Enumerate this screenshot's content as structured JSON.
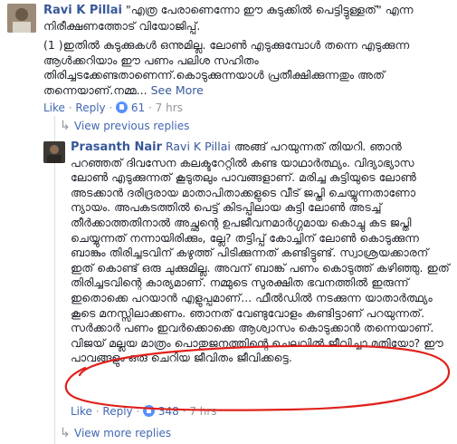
{
  "comment1": {
    "author": "Ravi K Pillai",
    "quote": "\"എത്ര പേരാണെന്നോ ഈ കുടുക്കിൽ പെട്ടിട്ടുള്ളത്\" എന്ന നിരീക്ഷണത്തോട് വിയോജിപ്പ്.",
    "body": "(1 )ഇതിൽ കുടുക്കുകൾ ഒന്നുമില്ല. ലോൺ എടുക്കുമ്പോൾ തന്നെ എടുക്കുന്ന ആൾക്കറിയാം ഈ പണം പലിശ സഹിതം തിരിച്ചടക്കേണ്ടതാണെന്ന്.കൊടുക്കുന്നയാൾ പ്രതീക്ഷിക്കുന്നതും അത് തന്നെയാണ്.നമ്മ...",
    "see_more": "See More",
    "like": "Like",
    "reply": "Reply",
    "like_count": "61",
    "time": "7 hrs"
  },
  "view_previous": "View previous replies",
  "comment2": {
    "author": "Prasanth Nair",
    "tag": "Ravi K Pillai",
    "body": "അങ്ങ് പറയുന്നത് തിയറി. ഞാൻ പറഞ്ഞത് ദിവസേന കലക്ടറേറ്റിൽ കണ്ട യാഥാർത്ഥ്യം. വിദ്യാഭ്യാസ ലോൺ എടുക്കുന്നത് കൂടുതലും പാവങ്ങളാണ്. മരിച്ച കുട്ടിയുടെ ലോൺ അടക്കാൻ ദരിദ്രരായ മാതാപിതാക്കളുടെ വീട് ജപ്തി ചെയ്യുന്നതാണോ ന്യായം. അപകടത്തിൽ പെട്ട് കിടപ്പിലായ കുട്ടി ലോൺ അടച്ച് തീർക്കാത്തതിനാൽ അച്ഛന്റെ ഉപജീവനമാർഗ്ഗമായ കൊച്ചു കട ജപ്തി ചെയ്യുന്നത് നന്നായിരിക്കും, ല്ലേ? തട്ടിപ്പ് കോച്ചിന് ലോൺ കൊടുക്കുന്ന ബാങ്കും തിരിച്ചടവിന് കഴുത്ത് പിടിക്കുന്നത് കണ്ടിട്ടുണ്ട്. സ്വാശ്രയക്കാരന് ഇത് കൊണ്ട് ഒരു ചുക്കുമില്ല. അവന് ബാങ്ക് പണം കൊടുത്ത് കഴിഞ്ഞു. ഇത് തിരിച്ചടവിന്റെ കാര്യമാണ്. നമ്മുടെ സുരക്ഷിത ഭവനത്തിൽ ഇരുന്ന് ഇതൊക്കെ പറയാൻ എളുപ്പമാണ്... ഫീൽഡിൽ നടക്കുന്ന യാതാർത്ഥ്യം കൂടെ മനസ്സിലാക്കണം. ഞാനത് വേണ്ടുവോളം കണ്ടിട്ടാണ് പറയുന്നത്. സർക്കാർ പണം ഇവർക്കൊക്കെ ആശ്വാസം കൊടുക്കാൻ തന്നെയാണ്. വിജയ് മല്ലയ മാത്രം പൊതുജനത്തിന്റെ ചെലവിൽ ജീവിച്ചാ മതിയോ? ഈ പാവങ്ങളും ഒരു ചെറിയ ജീവിതം ജീവിക്കട്ടെ.",
    "like": "Like",
    "reply": "Reply",
    "like_count": "348",
    "time": "7 hrs"
  },
  "view_more": "View more replies",
  "colors": {
    "link": "#365899",
    "meta": "#90949c",
    "annotation": "#e0201b"
  },
  "icons": [
    "reply-arrow-icon",
    "like-badge-icon"
  ]
}
